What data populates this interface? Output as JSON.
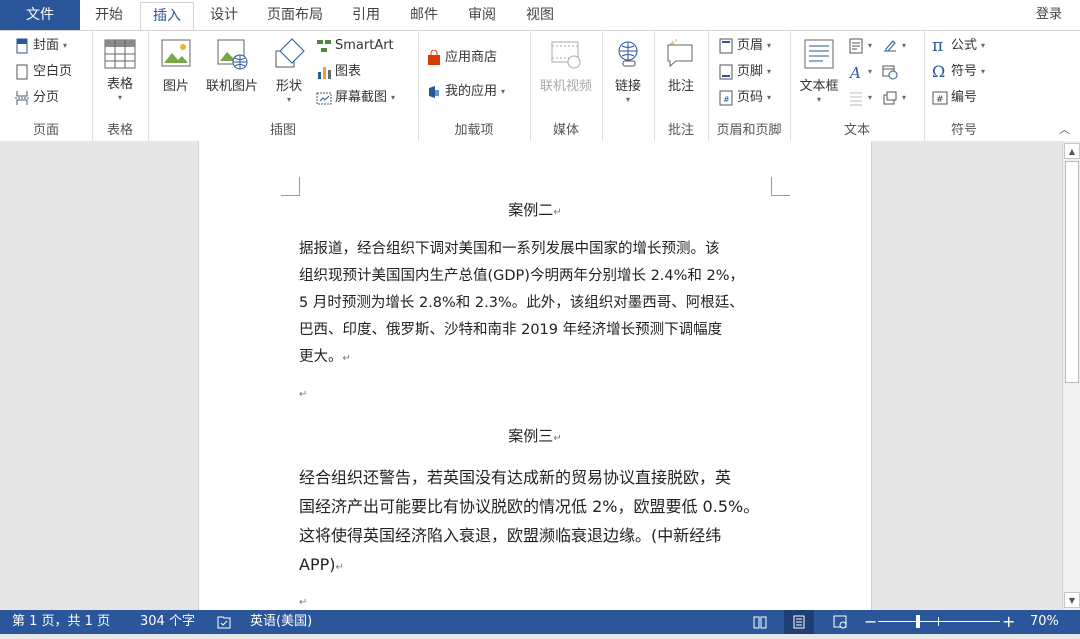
{
  "menu": {
    "file": "文件",
    "tabs": [
      "开始",
      "插入",
      "设计",
      "页面布局",
      "引用",
      "邮件",
      "审阅",
      "视图"
    ],
    "active_tab": "插入",
    "login": "登录"
  },
  "ribbon": {
    "pages": {
      "label": "页面",
      "cover": "封面",
      "blank": "空白页",
      "page_break": "分页"
    },
    "tables": {
      "label": "表格",
      "table": "表格"
    },
    "illustrations": {
      "label": "插图",
      "picture": "图片",
      "online_picture": "联机图片",
      "shapes": "形状",
      "smartart": "SmartArt",
      "chart": "图表",
      "screenshot": "屏幕截图"
    },
    "addins": {
      "label": "加载项",
      "store": "应用商店",
      "my_apps": "我的应用"
    },
    "media": {
      "label": "媒体",
      "online_video": "联机视频"
    },
    "links": {
      "link": "链接"
    },
    "comments": {
      "label": "批注",
      "comment": "批注"
    },
    "header_footer": {
      "label": "页眉和页脚",
      "header": "页眉",
      "footer": "页脚",
      "page_number": "页码"
    },
    "text": {
      "label": "文本",
      "textbox": "文本框"
    },
    "symbols": {
      "label": "符号",
      "equation": "公式",
      "symbol": "符号",
      "numbering": "编号"
    }
  },
  "document": {
    "case2_title": "案例二",
    "case2_lines": [
      "据报道，经合组织下调对美国和一系列发展中国家的增长预测。该",
      "组织现预计美国国内生产总值(GDP)今明两年分别增长  2.4%和  2%，",
      "5  月时预测为增长  2.8%和  2.3%。此外，该组织对墨西哥、阿根廷、",
      "巴西、印度、俄罗斯、沙特和南非 2019 年经济增长预测下调幅度",
      "更大。"
    ],
    "case3_title": "案例三",
    "case3_lines": [
      "经合组织还警告，若英国没有达成新的贸易协议直接脱欧，英",
      "国经济产出可能要比有协议脱欧的情况低  2%，欧盟要低  0.5%。",
      "这将使得英国经济陷入衰退，欧盟濒临衰退边缘。(中新经纬",
      "APP)"
    ],
    "para_mark": "↵"
  },
  "statusbar": {
    "page": "第 1 页，共 1 页",
    "words": "304 个字",
    "language": "英语(美国)",
    "zoom": "70%",
    "zoom_level": 0.7
  },
  "colors": {
    "accent": "#2b579a",
    "ribbon_bg": "#ffffff",
    "canvas": "#e6e6e6"
  }
}
